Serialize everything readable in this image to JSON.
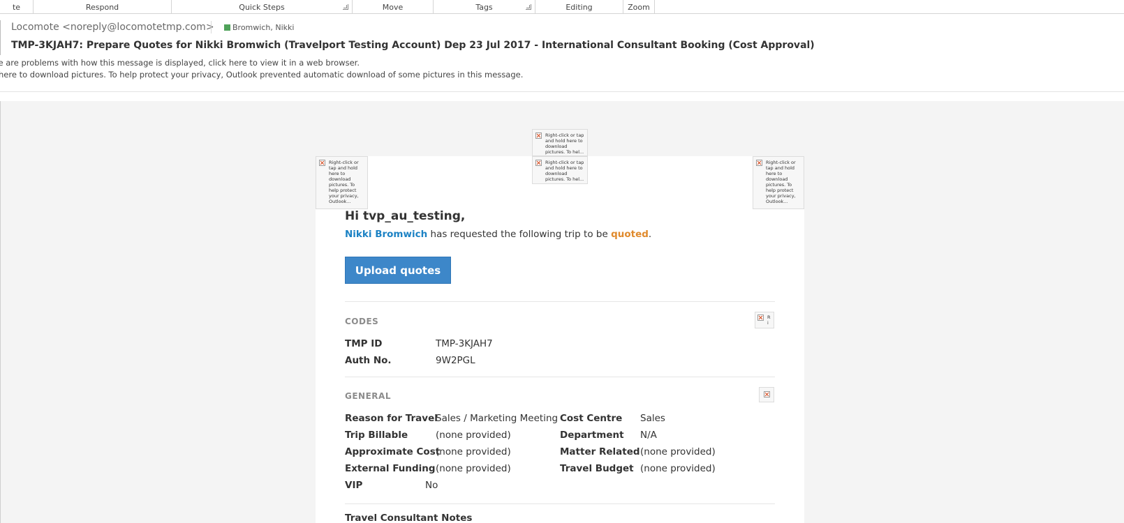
{
  "ribbon": {
    "groups": [
      "te",
      "Respond",
      "Quick Steps",
      "Move",
      "Tags",
      "Editing",
      "Zoom"
    ]
  },
  "header": {
    "sender": "Locomote <noreply@locomotetmp.com>",
    "recipient": "Bromwich, Nikki",
    "subject": "TMP-3KJAH7: Prepare Quotes for Nikki Bromwich (Travelport Testing Account) Dep 23 Jul 2017 - International Consultant Booking (Cost Approval)",
    "info_display": "re are problems with how this message is displayed, click here to view it in a web browser.",
    "info_pictures": "here to download pictures. To help protect your privacy, Outlook prevented automatic download of some pictures in this message."
  },
  "placeholders": {
    "top_center": "Right-click or tap and hold here to download pictures. To hel...",
    "mid_center": "Right-click or tap and hold here to download pictures. To hel...",
    "left": "Right-click or tap and hold here to download pictures. To help protect your privacy, Outlook...",
    "right": "Right-click or tap and hold here to download pictures. To help protect your privacy, Outlook...",
    "codes_icon": "R i"
  },
  "body": {
    "greeting": "Hi tvp_au_testing,",
    "requester": "Nikki Bromwich",
    "request_text": "has requested the following trip to be",
    "status": "quoted",
    "period": ".",
    "upload_button": "Upload quotes",
    "codes": {
      "title": "CODES",
      "rows": [
        {
          "label": "TMP ID",
          "value": "TMP-3KJAH7"
        },
        {
          "label": "Auth No.",
          "value": "9W2PGL"
        }
      ]
    },
    "general": {
      "title": "GENERAL",
      "left": [
        {
          "label": "Reason for Travel",
          "value": "Sales / Marketing Meeting"
        },
        {
          "label": "Trip Billable",
          "value": "(none provided)"
        },
        {
          "label": "Approximate Cost",
          "value": "(none provided)"
        },
        {
          "label": "External Funding",
          "value": "(none provided)"
        },
        {
          "label": "VIP",
          "value": "No"
        }
      ],
      "right": [
        {
          "label": "Cost Centre",
          "value": "Sales"
        },
        {
          "label": "Department",
          "value": "N/A"
        },
        {
          "label": "Matter Related",
          "value": "(none provided)"
        },
        {
          "label": "Travel Budget",
          "value": "(none provided)"
        }
      ]
    },
    "notes_title": "Travel Consultant Notes"
  }
}
